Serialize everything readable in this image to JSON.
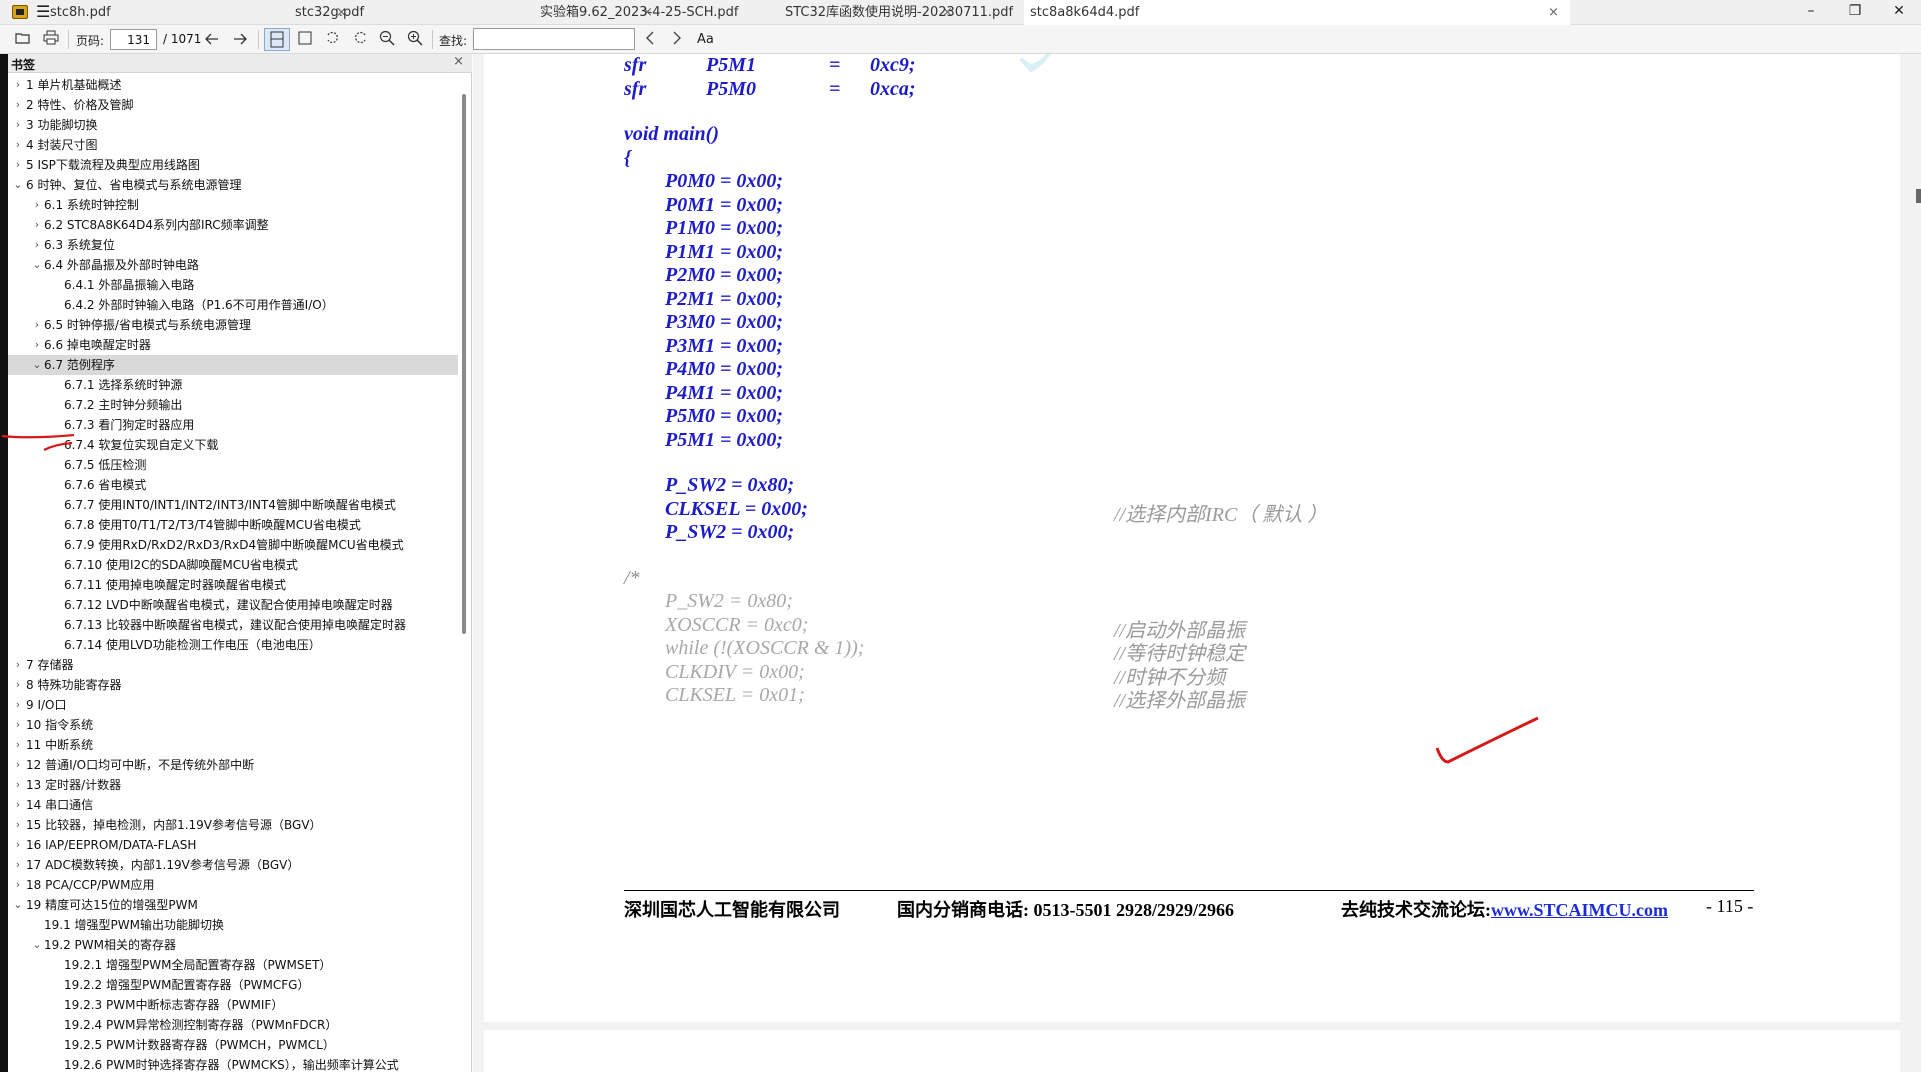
{
  "app": {
    "menu_icon": "hamburger-menu-icon",
    "logo_icon": "pdf-reader-logo-icon"
  },
  "tabs": [
    {
      "label": "stc8h.pdf",
      "active": false
    },
    {
      "label": "stc32g.pdf",
      "active": false
    },
    {
      "label": "实验箱9.62_2023-4-25-SCH.pdf",
      "active": false
    },
    {
      "label": "STC32库函数使用说明-20230711.pdf",
      "active": false
    },
    {
      "label": "stc8a8k64d4.pdf",
      "active": true
    }
  ],
  "tab_close_glyph": "×",
  "window": {
    "minimize": "–",
    "restore": "❐",
    "close": "✕"
  },
  "toolbar": {
    "page_label": "页码:",
    "page_current": "131",
    "page_total": "/ 1071",
    "search_label": "查找:",
    "search_value": "",
    "match_case_label": "Aa",
    "icons": [
      "open-icon",
      "print-icon",
      "prev-page-icon",
      "next-page-icon",
      "single-page-layout-icon",
      "fit-page-icon",
      "rotate-left-icon",
      "rotate-right-icon",
      "zoom-out-icon",
      "zoom-in-icon",
      "find-prev-icon",
      "find-next-icon"
    ]
  },
  "sidebar": {
    "title": "书签",
    "close_glyph": "×",
    "items": [
      {
        "level": 0,
        "state": "collapsed",
        "label": "1 单片机基础概述"
      },
      {
        "level": 0,
        "state": "collapsed",
        "label": "2 特性、价格及管脚"
      },
      {
        "level": 0,
        "state": "collapsed",
        "label": "3 功能脚切换"
      },
      {
        "level": 0,
        "state": "collapsed",
        "label": "4 封装尺寸图"
      },
      {
        "level": 0,
        "state": "collapsed",
        "label": "5 ISP下载流程及典型应用线路图"
      },
      {
        "level": 0,
        "state": "expanded",
        "label": "6 时钟、复位、省电模式与系统电源管理"
      },
      {
        "level": 1,
        "state": "collapsed",
        "label": "6.1 系统时钟控制"
      },
      {
        "level": 1,
        "state": "collapsed",
        "label": "6.2 STC8A8K64D4系列内部IRC频率调整"
      },
      {
        "level": 1,
        "state": "collapsed",
        "label": "6.3 系统复位"
      },
      {
        "level": 1,
        "state": "expanded",
        "label": "6.4 外部晶振及外部时钟电路"
      },
      {
        "level": 2,
        "state": "leaf",
        "label": "6.4.1 外部晶振输入电路"
      },
      {
        "level": 2,
        "state": "leaf",
        "label": "6.4.2 外部时钟输入电路（P1.6不可用作普通I/O）"
      },
      {
        "level": 1,
        "state": "collapsed",
        "label": "6.5 时钟停振/省电模式与系统电源管理"
      },
      {
        "level": 1,
        "state": "collapsed",
        "label": "6.6 掉电唤醒定时器"
      },
      {
        "level": 1,
        "state": "expanded",
        "label": "6.7 范例程序",
        "selected": true
      },
      {
        "level": 2,
        "state": "leaf",
        "label": "6.7.1 选择系统时钟源"
      },
      {
        "level": 2,
        "state": "leaf",
        "label": "6.7.2 主时钟分频输出"
      },
      {
        "level": 2,
        "state": "leaf",
        "label": "6.7.3 看门狗定时器应用"
      },
      {
        "level": 2,
        "state": "leaf",
        "label": "6.7.4 软复位实现自定义下载"
      },
      {
        "level": 2,
        "state": "leaf",
        "label": "6.7.5 低压检测"
      },
      {
        "level": 2,
        "state": "leaf",
        "label": "6.7.6 省电模式"
      },
      {
        "level": 2,
        "state": "leaf",
        "label": "6.7.7 使用INT0/INT1/INT2/INT3/INT4管脚中断唤醒省电模式"
      },
      {
        "level": 2,
        "state": "leaf",
        "label": "6.7.8 使用T0/T1/T2/T3/T4管脚中断唤醒MCU省电模式"
      },
      {
        "level": 2,
        "state": "leaf",
        "label": "6.7.9 使用RxD/RxD2/RxD3/RxD4管脚中断唤醒MCU省电模式"
      },
      {
        "level": 2,
        "state": "leaf",
        "label": "6.7.10 使用I2C的SDA脚唤醒MCU省电模式"
      },
      {
        "level": 2,
        "state": "leaf",
        "label": "6.7.11 使用掉电唤醒定时器唤醒省电模式"
      },
      {
        "level": 2,
        "state": "leaf",
        "label": "6.7.12 LVD中断唤醒省电模式，建议配合使用掉电唤醒定时器"
      },
      {
        "level": 2,
        "state": "leaf",
        "label": "6.7.13 比较器中断唤醒省电模式，建议配合使用掉电唤醒定时器"
      },
      {
        "level": 2,
        "state": "leaf",
        "label": "6.7.14 使用LVD功能检测工作电压（电池电压）"
      },
      {
        "level": 0,
        "state": "collapsed",
        "label": "7 存储器"
      },
      {
        "level": 0,
        "state": "collapsed",
        "label": "8 特殊功能寄存器"
      },
      {
        "level": 0,
        "state": "collapsed",
        "label": "9 I/O口"
      },
      {
        "level": 0,
        "state": "collapsed",
        "label": "10 指令系统"
      },
      {
        "level": 0,
        "state": "collapsed",
        "label": "11 中断系统"
      },
      {
        "level": 0,
        "state": "collapsed",
        "label": "12 普通I/O口均可中断，不是传统外部中断"
      },
      {
        "level": 0,
        "state": "collapsed",
        "label": "13 定时器/计数器"
      },
      {
        "level": 0,
        "state": "collapsed",
        "label": "14 串口通信"
      },
      {
        "level": 0,
        "state": "collapsed",
        "label": "15 比较器，掉电检测，内部1.19V参考信号源（BGV）"
      },
      {
        "level": 0,
        "state": "collapsed",
        "label": "16 IAP/EEPROM/DATA-FLASH"
      },
      {
        "level": 0,
        "state": "collapsed",
        "label": "17 ADC模数转换，内部1.19V参考信号源（BGV）"
      },
      {
        "level": 0,
        "state": "collapsed",
        "label": "18 PCA/CCP/PWM应用"
      },
      {
        "level": 0,
        "state": "expanded",
        "label": "19 精度可达15位的增强型PWM"
      },
      {
        "level": 1,
        "state": "leaf",
        "label": "19.1 增强型PWM输出功能脚切换"
      },
      {
        "level": 1,
        "state": "expanded",
        "label": "19.2 PWM相关的寄存器"
      },
      {
        "level": 2,
        "state": "leaf",
        "label": "19.2.1 增强型PWM全局配置寄存器（PWMSET）"
      },
      {
        "level": 2,
        "state": "leaf",
        "label": "19.2.2 增强型PWM配置寄存器（PWMCFG）"
      },
      {
        "level": 2,
        "state": "leaf",
        "label": "19.2.3 PWM中断标志寄存器（PWMIF）"
      },
      {
        "level": 2,
        "state": "leaf",
        "label": "19.2.4 PWM异常检测控制寄存器（PWMnFDCR）"
      },
      {
        "level": 2,
        "state": "leaf",
        "label": "19.2.5 PWM计数器寄存器（PWMCH，PWMCL）"
      },
      {
        "level": 2,
        "state": "leaf",
        "label": "19.2.6 PWM时钟选择寄存器（PWMCKS），输出频率计算公式"
      }
    ]
  },
  "document": {
    "watermark": "STC",
    "code_lines": [
      {
        "kind": "sfr",
        "a": "sfr",
        "b": "P5M1",
        "c": "=",
        "d": "0xc9;"
      },
      {
        "kind": "sfr",
        "a": "sfr",
        "b": "P5M0",
        "c": "=",
        "d": "0xca;"
      },
      {
        "kind": "blank"
      },
      {
        "kind": "top",
        "text": "void main()"
      },
      {
        "kind": "top",
        "text": "{"
      },
      {
        "kind": "body",
        "text": "P0M0 = 0x00;"
      },
      {
        "kind": "body",
        "text": "P0M1 = 0x00;"
      },
      {
        "kind": "body",
        "text": "P1M0 = 0x00;"
      },
      {
        "kind": "body",
        "text": "P1M1 = 0x00;"
      },
      {
        "kind": "body",
        "text": "P2M0 = 0x00;"
      },
      {
        "kind": "body",
        "text": "P2M1 = 0x00;"
      },
      {
        "kind": "body",
        "text": "P3M0 = 0x00;"
      },
      {
        "kind": "body",
        "text": "P3M1 = 0x00;"
      },
      {
        "kind": "body",
        "text": "P4M0 = 0x00;"
      },
      {
        "kind": "body",
        "text": "P4M1 = 0x00;"
      },
      {
        "kind": "body",
        "text": "P5M0 = 0x00;"
      },
      {
        "kind": "body",
        "text": "P5M1 = 0x00;"
      },
      {
        "kind": "blank"
      },
      {
        "kind": "body",
        "text": "P_SW2 = 0x80;"
      },
      {
        "kind": "body",
        "text": "CLKSEL = 0x00;",
        "comment": "//选择内部IRC（  默认  ）"
      },
      {
        "kind": "body",
        "text": "P_SW2 = 0x00;"
      },
      {
        "kind": "blank"
      },
      {
        "kind": "ctop",
        "text": "/*"
      },
      {
        "kind": "cbody",
        "text": "P_SW2 = 0x80;"
      },
      {
        "kind": "cbody",
        "text": "XOSCCR = 0xc0;",
        "comment": "//启动外部晶振"
      },
      {
        "kind": "cbody",
        "text": "while (!(XOSCCR & 1));",
        "comment": "//等待时钟稳定"
      },
      {
        "kind": "cbody",
        "text": "CLKDIV = 0x00;",
        "comment": "//时钟不分频"
      },
      {
        "kind": "cbody",
        "text": "CLKSEL = 0x01;",
        "comment": "//选择外部晶振"
      }
    ],
    "footer": {
      "company": "深圳国芯人工智能有限公司",
      "phone": "国内分销商电话: 0513-5501 2928/2929/2966",
      "forum_prefix": "去纯技术交流论坛:",
      "forum_link": "www.STCAIMCU.com",
      "page_number": "- 115 -"
    }
  },
  "annotations": {
    "pen_color": "#d61a1a"
  }
}
